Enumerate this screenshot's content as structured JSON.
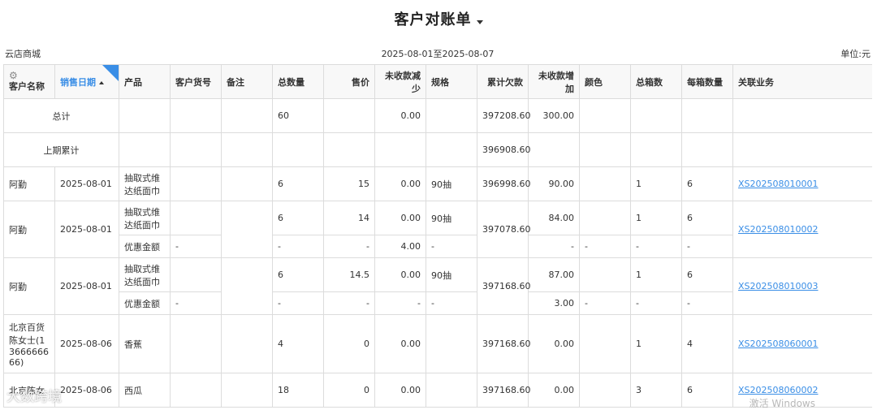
{
  "header": {
    "title": "客户对账单"
  },
  "meta": {
    "shop": "云店商城",
    "date_range": "2025-08-01至2025-08-07",
    "unit": "单位:元"
  },
  "columns": {
    "customer": "客户名称",
    "sale_date": "销售日期",
    "product": "产品",
    "cust_sku": "客户货号",
    "remark": "备注",
    "total_qty": "总数量",
    "price": "售价",
    "unrecv_dec": "未收款减少",
    "spec": "规格",
    "cum_owed": "累计欠款",
    "unrecv_inc": "未收款增加",
    "color": "颜色",
    "boxes": "总箱数",
    "per_box": "每箱数量",
    "related": "关联业务"
  },
  "summary": {
    "total_label": "总计",
    "total_qty": "60",
    "total_unrecv_dec": "0.00",
    "total_cum_owed": "397208.60",
    "total_unrecv_inc": "300.00",
    "prev_label": "上期累计",
    "prev_cum_owed": "396908.60"
  },
  "rows": [
    {
      "customer": "阿勤",
      "date": "2025-08-01",
      "product": "抽取式维达纸面巾",
      "qty": "6",
      "price": "15",
      "dec": "0.00",
      "spec": "90抽",
      "owed": "396998.60",
      "inc": "90.00",
      "boxes": "1",
      "per_box": "6",
      "link": "XS202508010001"
    },
    {
      "customer": "阿勤",
      "date": "2025-08-01",
      "product": "抽取式维达纸面巾",
      "qty": "6",
      "price": "14",
      "dec": "0.00",
      "spec": "90抽",
      "owed": "397078.60",
      "inc": "84.00",
      "boxes": "1",
      "per_box": "6",
      "link": "XS202508010002",
      "sub": {
        "product": "优惠金额",
        "dash": "-",
        "dec": "4.00"
      }
    },
    {
      "customer": "阿勤",
      "date": "2025-08-01",
      "product": "抽取式维达纸面巾",
      "qty": "6",
      "price": "14.5",
      "dec": "0.00",
      "spec": "90抽",
      "owed": "397168.60",
      "inc": "87.00",
      "boxes": "1",
      "per_box": "6",
      "link": "XS202508010003",
      "sub": {
        "product": "优惠金额",
        "dash": "-",
        "inc": "3.00"
      }
    },
    {
      "customer": "北京百货陈女士(1366666666)",
      "date": "2025-08-06",
      "product": "香蕉",
      "qty": "4",
      "price": "0",
      "dec": "0.00",
      "owed": "397168.60",
      "inc": "0.00",
      "boxes": "1",
      "per_box": "4",
      "link": "XS202508060001"
    },
    {
      "customer": "北京陈女",
      "date": "2025-08-06",
      "product": "西瓜",
      "qty": "18",
      "price": "0",
      "dec": "0.00",
      "owed": "397168.60",
      "inc": "0.00",
      "boxes": "3",
      "per_box": "6",
      "link": "XS202508060002"
    }
  ],
  "watermark": {
    "left": "大数跨境",
    "right": "激活 Windows"
  }
}
